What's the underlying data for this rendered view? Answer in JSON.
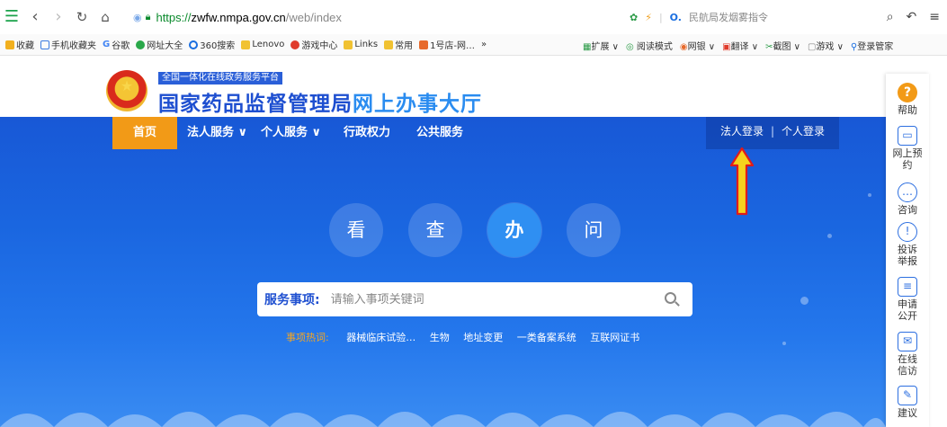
{
  "browser": {
    "url": {
      "scheme": "https://",
      "host": "zwfw.nmpa.gov.cn",
      "path": "/web/index"
    },
    "address_right": {
      "hint": "民航局发烟雾指令"
    },
    "bookmarks": [
      "收藏",
      "手机收藏夹",
      "谷歌",
      "网址大全",
      "360搜索",
      "Lenovo",
      "游戏中心",
      "Links",
      "常用",
      "1号店-网…",
      "»"
    ],
    "bookbar_right": [
      "扩展",
      "阅读模式",
      "网银",
      "翻译",
      "截图",
      "游戏",
      "登录管家"
    ]
  },
  "header": {
    "platform_tag": "全国一体化在线政务服务平台",
    "site_name_main": "国家药品监督管理局",
    "site_name_sub": "网上办事大厅"
  },
  "menu": {
    "home": "首页",
    "items": [
      "法人服务 ∨",
      "个人服务 ∨",
      "行政权力",
      "公共服务"
    ],
    "login_corp": "法人登录",
    "login_sep": "|",
    "login_person": "个人登录"
  },
  "circles": [
    "看",
    "查",
    "办",
    "问"
  ],
  "search": {
    "label": "服务事项:",
    "placeholder": "请输入事项关键词"
  },
  "hot": {
    "label": "事项热词:",
    "keywords": [
      "器械临床试验…",
      "生物",
      "地址变更",
      "一类备案系统",
      "互联网证书"
    ]
  },
  "sidebar": {
    "help": "帮助",
    "items": [
      "网上预约",
      "咨询",
      "投诉举报",
      "申请公开",
      "在线信访",
      "建议"
    ]
  },
  "colors": {
    "banner_blue": "#1a66e0",
    "home_orange": "#f29a17",
    "arrow_red": "#e01b1b",
    "arrow_yellow": "#f5d21e"
  }
}
